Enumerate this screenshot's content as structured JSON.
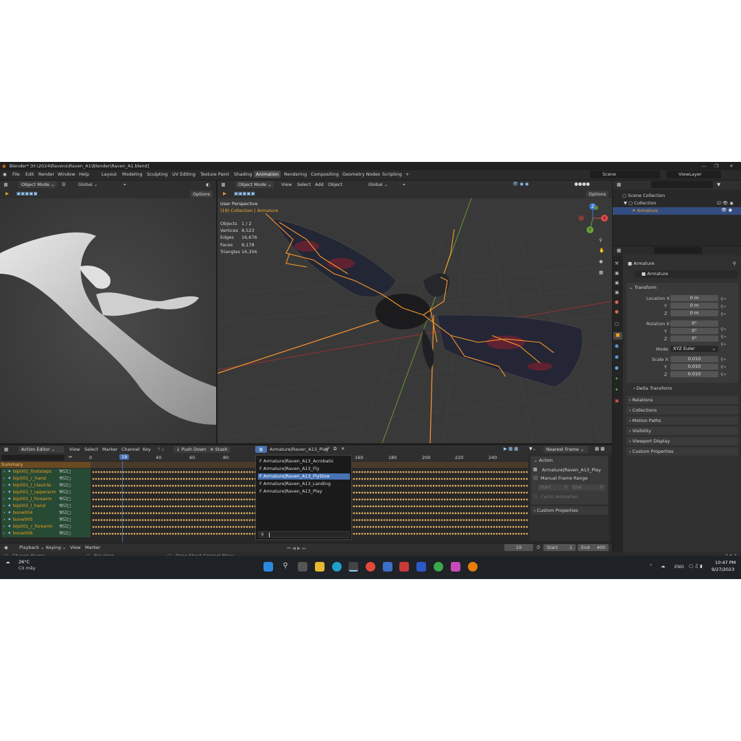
{
  "window": {
    "title": "Blender* [H:\\2024\\Ravens\\Raven_A1\\Blender\\Raven_A1.blend]",
    "controls": [
      "—",
      "❐",
      "✕"
    ]
  },
  "menu": [
    "File",
    "Edit",
    "Render",
    "Window",
    "Help"
  ],
  "workspaces": [
    "Layout",
    "Modeling",
    "Sculpting",
    "UV Editing",
    "Texture Paint",
    "Shading",
    "Animation",
    "Rendering",
    "Compositing",
    "Geometry Nodes",
    "Scripting"
  ],
  "active_workspace": "Animation",
  "scene": "Scene",
  "view_layer": "ViewLayer",
  "left_view": {
    "mode": "Object Mode",
    "orientation": "Global",
    "options": "Options"
  },
  "viewport": {
    "mode": "Object Mode",
    "menu": [
      "View",
      "Select",
      "Add",
      "Object"
    ],
    "orientation": "Global",
    "options": "Options",
    "perspective": "User Perspective",
    "collection": "(19) Collection | Armature",
    "stats": [
      {
        "k": "Objects",
        "v": "1 / 2"
      },
      {
        "k": "Vertices",
        "v": "8,523"
      },
      {
        "k": "Edges",
        "v": "16,676"
      },
      {
        "k": "Faces",
        "v": "8,178"
      },
      {
        "k": "Triangles",
        "v": "16,356"
      }
    ],
    "gizmo": {
      "x": "X",
      "y": "Y",
      "z": "Z"
    }
  },
  "outliner": {
    "root": "Scene Collection",
    "collection": "Collection",
    "armature": "Armature"
  },
  "properties": {
    "object": "Armature",
    "data": "Armature",
    "transform": "Transform",
    "location_label": "Location X",
    "location": [
      "0 m",
      "0 m",
      "0 m"
    ],
    "rotation_label": "Rotation X",
    "rotation": [
      "0°",
      "0°",
      "0°"
    ],
    "mode_label": "Mode",
    "mode": "XYZ Euler",
    "scale_label": "Scale X",
    "scale": [
      "0.010",
      "0.010",
      "0.010"
    ],
    "axis_y": "Y",
    "axis_z": "Z",
    "sections": [
      "Delta Transform",
      "Relations",
      "Collections",
      "Motion Paths",
      "Visibility",
      "Viewport Display",
      "Custom Properties"
    ]
  },
  "action_editor": {
    "mode": "Action Editor",
    "menu": [
      "View",
      "Select",
      "Marker",
      "Channel",
      "Key"
    ],
    "push_down": "Push Down",
    "stash": "Stash",
    "action": "Armature|Raven_A13_Play",
    "snap": "Nearest Frame",
    "ruler": [
      "0",
      "19",
      "40",
      "60",
      "80",
      "160",
      "180",
      "200",
      "220",
      "240"
    ],
    "summary": "Summary",
    "channels": [
      "bip001_footsteps",
      "bip001_r_hand",
      "bip001_l_clavicle",
      "bip001_l_upperarm",
      "bip001_l_forearm",
      "bip001_l_hand",
      "bone004",
      "bone005",
      "bip001_r_forearm",
      "bone006"
    ]
  },
  "action_dropdown": {
    "items": [
      "F Armature|Raven_A13_Acrobatic",
      "F Armature|Raven_A13_Fly",
      "F Armature|Raven_A13_FlySlow",
      "F Armature|Raven_A13_Landing",
      "F Armature|Raven_A13_Play"
    ],
    "selected_index": 2
  },
  "action_panel": {
    "title": "Action",
    "name": "Armature|Raven_A13_Play",
    "manual_range": "Manual Frame Range",
    "start_label": "Start",
    "start": "0",
    "end_label": "End",
    "end": "0",
    "cyclic": "Cyclic Animation",
    "custom": "Custom Properties"
  },
  "timeline": {
    "menu": [
      "Playback",
      "Keying",
      "View",
      "Marker"
    ],
    "current": "19",
    "start_label": "Start",
    "start": "1",
    "end_label": "End",
    "end": "400"
  },
  "status": {
    "left": "Change Frame",
    "middle": "Pan View",
    "right": "Dope Sheet Context Menu",
    "version": "3.6.2"
  },
  "taskbar": {
    "temp": "26°C",
    "weather": "Có mây",
    "lang": "ENG",
    "time": "10:47 PM",
    "date": "9/27/2023"
  },
  "colors": {
    "accent": "#4772b3",
    "bones": "#ff9a2e",
    "selection": "#f0a020",
    "channel_bg": "#274a34"
  }
}
